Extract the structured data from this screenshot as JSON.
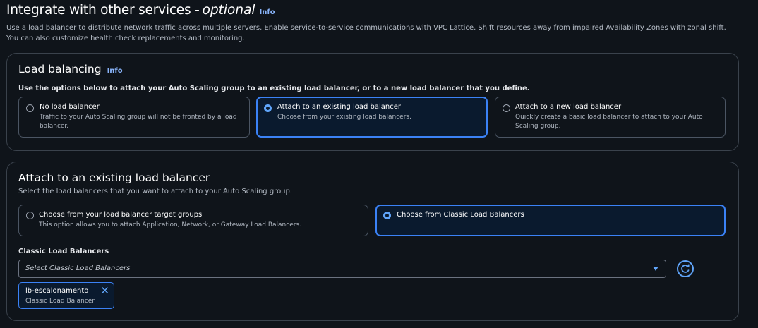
{
  "header": {
    "title": "Integrate with other services -",
    "title_optional": "optional",
    "info": "Info",
    "description": "Use a load balancer to distribute network traffic across multiple servers. Enable service-to-service communications with VPC Lattice. Shift resources away from impaired Availability Zones with zonal shift. You can also customize health check replacements and monitoring."
  },
  "load_balancing": {
    "title": "Load balancing",
    "info": "Info",
    "instructions": "Use the options below to attach your Auto Scaling group to an existing load balancer, or to a new load balancer that you define.",
    "options": [
      {
        "label": "No load balancer",
        "desc": "Traffic to your Auto Scaling group will not be fronted by a load balancer.",
        "selected": false
      },
      {
        "label": "Attach to an existing load balancer",
        "desc": "Choose from your existing load balancers.",
        "selected": true
      },
      {
        "label": "Attach to a new load balancer",
        "desc": "Quickly create a basic load balancer to attach to your Auto Scaling group.",
        "selected": false
      }
    ]
  },
  "attach_existing": {
    "title": "Attach to an existing load balancer",
    "subtitle": "Select the load balancers that you want to attach to your Auto Scaling group.",
    "options": [
      {
        "label": "Choose from your load balancer target groups",
        "desc": "This option allows you to attach Application, Network, or Gateway Load Balancers.",
        "selected": false
      },
      {
        "label": "Choose from Classic Load Balancers",
        "desc": "",
        "selected": true
      }
    ],
    "field_label": "Classic Load Balancers",
    "select_placeholder": "Select Classic Load Balancers",
    "tokens": [
      {
        "name": "lb-escalonamento",
        "type": "Classic Load Balancer"
      }
    ]
  },
  "colors": {
    "background": "#0f141a",
    "accent": "#60a5fa",
    "selected_border": "#3b82f6",
    "selected_fill": "#0a1a2e"
  },
  "icons": [
    "caret-down-icon",
    "refresh-icon",
    "close-icon"
  ]
}
